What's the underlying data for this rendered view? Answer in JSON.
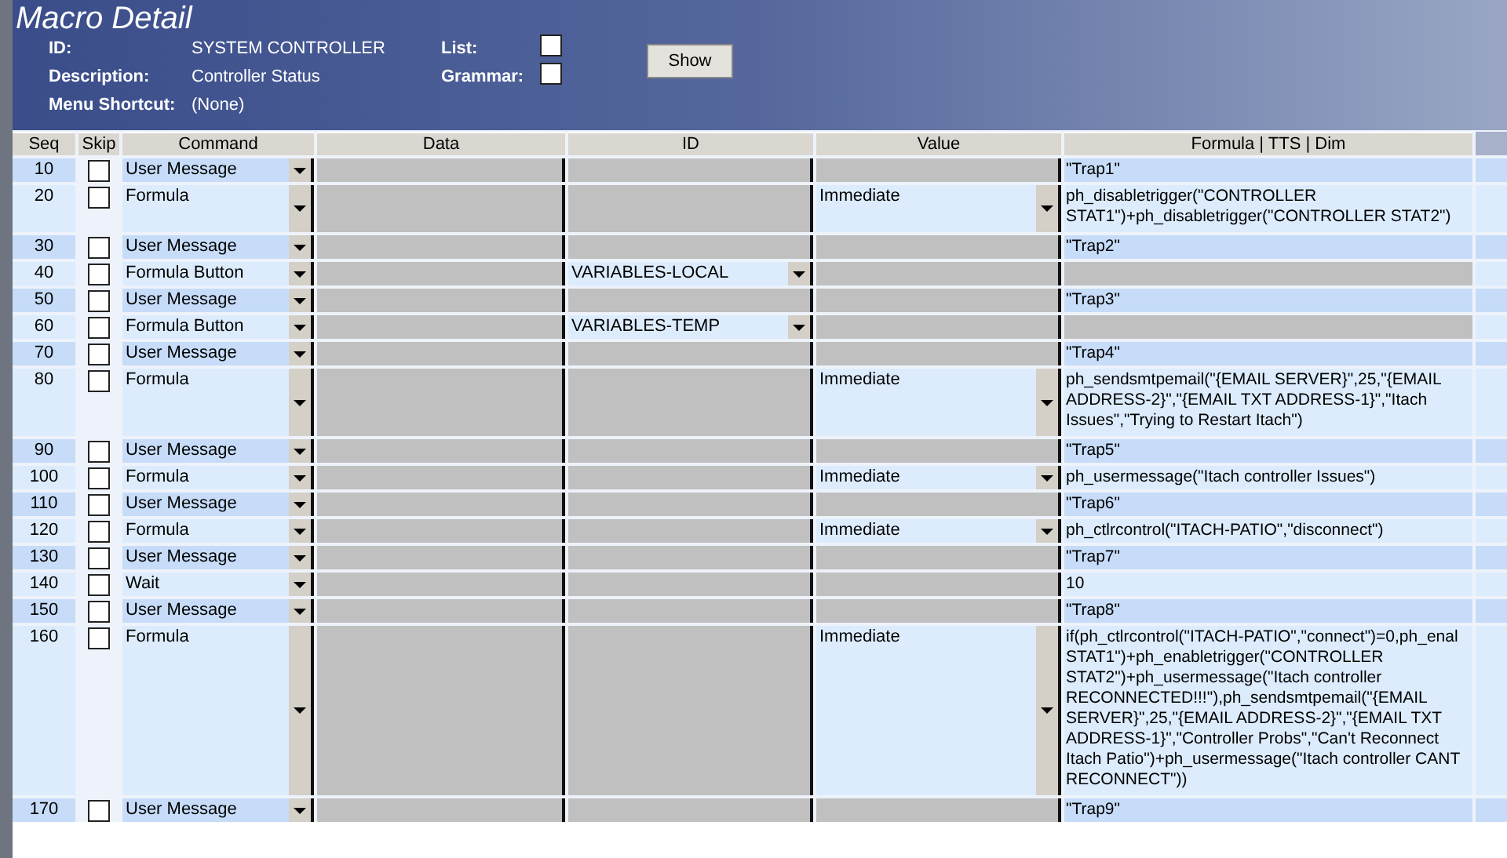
{
  "window": {
    "title": "Macro Detail"
  },
  "fields": [
    {
      "label": "ID:",
      "value": "SYSTEM CONTROLLER"
    },
    {
      "label": "Description:",
      "value": "Controller Status"
    },
    {
      "label": "Menu Shortcut:",
      "value": "(None)"
    }
  ],
  "options": [
    {
      "label": "List:",
      "checked": false
    },
    {
      "label": "Grammar:",
      "checked": false
    }
  ],
  "show_button": "Show",
  "table": {
    "columns": [
      "Seq",
      "Skip",
      "Command",
      "Data",
      "ID",
      "Value",
      "Formula | TTS | Dim"
    ],
    "rows": [
      {
        "kind": "message",
        "seq": "10",
        "skip": false,
        "command": "User Message",
        "formula": [
          "\"Trap1\""
        ]
      },
      {
        "kind": "formula",
        "seq": "20",
        "skip": false,
        "command": "Formula",
        "value": "Immediate",
        "formula": [
          "ph_disabletrigger(\"CONTROLLER",
          "STAT1\")+ph_disabletrigger(\"CONTROLLER STAT2\")"
        ]
      },
      {
        "kind": "message",
        "seq": "30",
        "skip": false,
        "command": "User Message",
        "formula": [
          "\"Trap2\""
        ]
      },
      {
        "kind": "button",
        "seq": "40",
        "skip": false,
        "command": "Formula Button",
        "id": "VARIABLES-LOCAL"
      },
      {
        "kind": "message",
        "seq": "50",
        "skip": false,
        "command": "User Message",
        "formula": [
          "\"Trap3\""
        ]
      },
      {
        "kind": "button",
        "seq": "60",
        "skip": false,
        "command": "Formula Button",
        "id": "VARIABLES-TEMP"
      },
      {
        "kind": "message",
        "seq": "70",
        "skip": false,
        "command": "User Message",
        "formula": [
          "\"Trap4\""
        ]
      },
      {
        "kind": "formula",
        "seq": "80",
        "skip": false,
        "command": "Formula",
        "value": "Immediate",
        "formula": [
          "ph_sendsmtpemail(\"{EMAIL SERVER}\",25,\"{EMAIL",
          "ADDRESS-2}\",\"{EMAIL TXT ADDRESS-1}\",\"Itach",
          "Issues\",\"Trying to Restart Itach\")"
        ]
      },
      {
        "kind": "message",
        "seq": "90",
        "skip": false,
        "command": "User Message",
        "formula": [
          "\"Trap5\""
        ]
      },
      {
        "kind": "formula",
        "seq": "100",
        "skip": false,
        "command": "Formula",
        "value": "Immediate",
        "formula": [
          "ph_usermessage(\"Itach controller Issues\")"
        ]
      },
      {
        "kind": "message",
        "seq": "110",
        "skip": false,
        "command": "User Message",
        "formula": [
          "\"Trap6\""
        ]
      },
      {
        "kind": "formula",
        "seq": "120",
        "skip": false,
        "command": "Formula",
        "value": "Immediate",
        "formula": [
          "ph_ctlrcontrol(\"ITACH-PATIO\",\"disconnect\")"
        ]
      },
      {
        "kind": "message",
        "seq": "130",
        "skip": false,
        "command": "User Message",
        "formula": [
          "\"Trap7\""
        ]
      },
      {
        "kind": "wait",
        "seq": "140",
        "skip": false,
        "command": "Wait",
        "formula": [
          "10"
        ]
      },
      {
        "kind": "message",
        "seq": "150",
        "skip": false,
        "command": "User Message",
        "formula": [
          "\"Trap8\""
        ]
      },
      {
        "kind": "formula",
        "seq": "160",
        "skip": false,
        "command": "Formula",
        "value": "Immediate",
        "formula": [
          "if(ph_ctlrcontrol(\"ITACH-PATIO\",\"connect\")=0,ph_enal",
          "STAT1\")+ph_enabletrigger(\"CONTROLLER",
          "STAT2\")+ph_usermessage(\"Itach controller",
          "RECONNECTED!!!\"),ph_sendsmtpemail(\"{EMAIL",
          "SERVER}\",25,\"{EMAIL ADDRESS-2}\",\"{EMAIL TXT",
          "ADDRESS-1}\",\"Controller Probs\",\"Can't Reconnect",
          "Itach Patio\")+ph_usermessage(\"Itach controller CANT",
          "RECONNECT\"))"
        ]
      },
      {
        "kind": "message",
        "seq": "170",
        "skip": false,
        "command": "User Message",
        "formula": [
          "\"Trap9\""
        ]
      }
    ]
  }
}
